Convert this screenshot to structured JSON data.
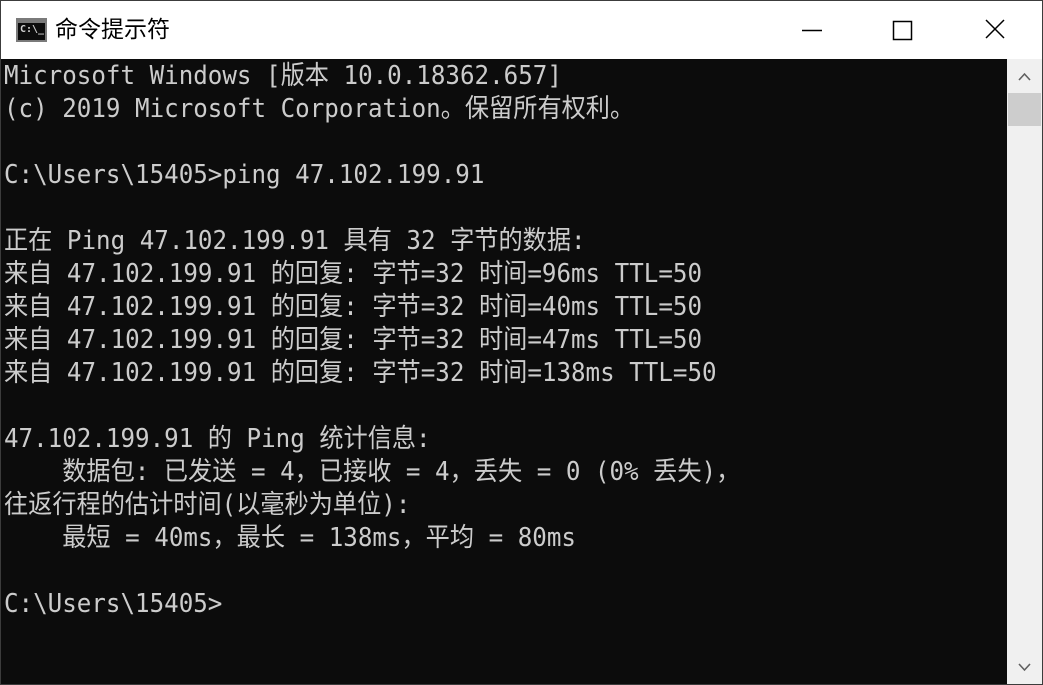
{
  "window": {
    "title": "命令提示符",
    "app_icon_text": "C:\\_"
  },
  "console": {
    "lines": [
      "Microsoft Windows [版本 10.0.18362.657]",
      "(c) 2019 Microsoft Corporation。保留所有权利。",
      "",
      "C:\\Users\\15405>ping 47.102.199.91",
      "",
      "正在 Ping 47.102.199.91 具有 32 字节的数据:",
      "来自 47.102.199.91 的回复: 字节=32 时间=96ms TTL=50",
      "来自 47.102.199.91 的回复: 字节=32 时间=40ms TTL=50",
      "来自 47.102.199.91 的回复: 字节=32 时间=47ms TTL=50",
      "来自 47.102.199.91 的回复: 字节=32 时间=138ms TTL=50",
      "",
      "47.102.199.91 的 Ping 统计信息:",
      "    数据包: 已发送 = 4，已接收 = 4，丢失 = 0 (0% 丢失)，",
      "往返行程的估计时间(以毫秒为单位):",
      "    最短 = 40ms，最长 = 138ms，平均 = 80ms",
      "",
      "C:\\Users\\15405>"
    ]
  },
  "colors": {
    "console_bg": "#0c0c0c",
    "console_text": "#cccccc",
    "titlebar_bg": "#ffffff",
    "scrollbar_bg": "#f0f0f0",
    "scroll_thumb": "#cdcdcd"
  },
  "icons": {
    "minimize": "minimize-icon",
    "maximize": "maximize-icon",
    "close": "close-icon",
    "scroll_up": "chevron-up-icon",
    "scroll_down": "chevron-down-icon"
  }
}
